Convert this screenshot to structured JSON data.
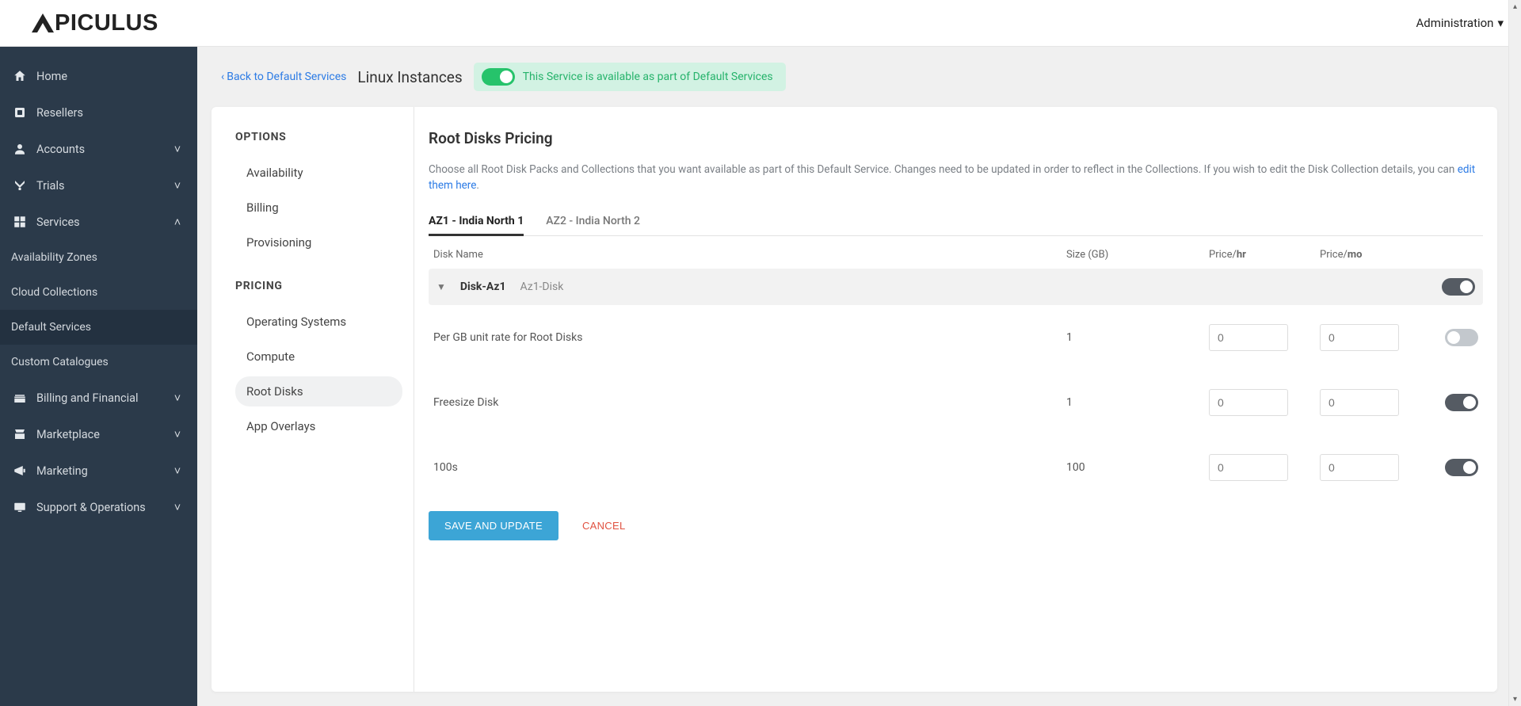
{
  "header": {
    "brand": "APICULUS",
    "admin_label": "Administration"
  },
  "sidebar": {
    "items": [
      {
        "icon": "home",
        "label": "Home",
        "expandable": false
      },
      {
        "icon": "resellers",
        "label": "Resellers",
        "expandable": false
      },
      {
        "icon": "accounts",
        "label": "Accounts",
        "expandable": true,
        "open": false
      },
      {
        "icon": "trials",
        "label": "Trials",
        "expandable": true,
        "open": false
      },
      {
        "icon": "services",
        "label": "Services",
        "expandable": true,
        "open": true
      },
      {
        "icon": "billing",
        "label": "Billing and Financial",
        "expandable": true,
        "open": false
      },
      {
        "icon": "marketplace",
        "label": "Marketplace",
        "expandable": true,
        "open": false
      },
      {
        "icon": "marketing",
        "label": "Marketing",
        "expandable": true,
        "open": false
      },
      {
        "icon": "support",
        "label": "Support & Operations",
        "expandable": true,
        "open": false
      }
    ],
    "services_sub": [
      {
        "label": "Availability Zones"
      },
      {
        "label": "Cloud Collections"
      },
      {
        "label": "Default Services",
        "active": true
      },
      {
        "label": "Custom Catalogues"
      }
    ]
  },
  "page": {
    "back_label": "Back to Default Services",
    "title": "Linux Instances",
    "badge_text": "This Service is available as part of Default Services"
  },
  "options": {
    "section1_title": "OPTIONS",
    "section1_items": [
      "Availability",
      "Billing",
      "Provisioning"
    ],
    "section2_title": "PRICING",
    "section2_items": [
      "Operating Systems",
      "Compute",
      "Root Disks",
      "App Overlays"
    ],
    "active": "Root Disks"
  },
  "main": {
    "title": "Root Disks Pricing",
    "description": "Choose all Root Disk Packs and Collections that you want available as part of this Default Service. Changes need to be updated in order to reflect in the Collections. If you wish to edit the Disk Collection details, you can ",
    "edit_link": "edit them here",
    "tabs": [
      "AZ1 - India North 1",
      "AZ2 - India North 2"
    ],
    "active_tab": 0,
    "columns": {
      "name": "Disk Name",
      "size": "Size (GB)",
      "phr_prefix": "Price/",
      "phr_bold": "hr",
      "pmo_prefix": "Price/",
      "pmo_bold": "mo"
    },
    "group": {
      "name": "Disk-Az1",
      "desc": "Az1-Disk",
      "enabled": true
    },
    "rows": [
      {
        "name": "Per GB unit rate for Root Disks",
        "size": "1",
        "phr": "0",
        "pmo": "0",
        "phr_disabled": false,
        "pmo_disabled": false,
        "enabled": false,
        "show_toggle": true
      },
      {
        "name": "Freesize Disk",
        "size": "1",
        "phr": "0",
        "pmo": "0",
        "phr_disabled": true,
        "pmo_disabled": true,
        "enabled": true,
        "show_toggle": true
      },
      {
        "name": "100s",
        "size": "100",
        "phr": "0",
        "pmo": "0",
        "phr_disabled": true,
        "pmo_disabled": true,
        "enabled": true,
        "show_toggle": true
      }
    ],
    "save_label": "SAVE AND UPDATE",
    "cancel_label": "CANCEL"
  }
}
